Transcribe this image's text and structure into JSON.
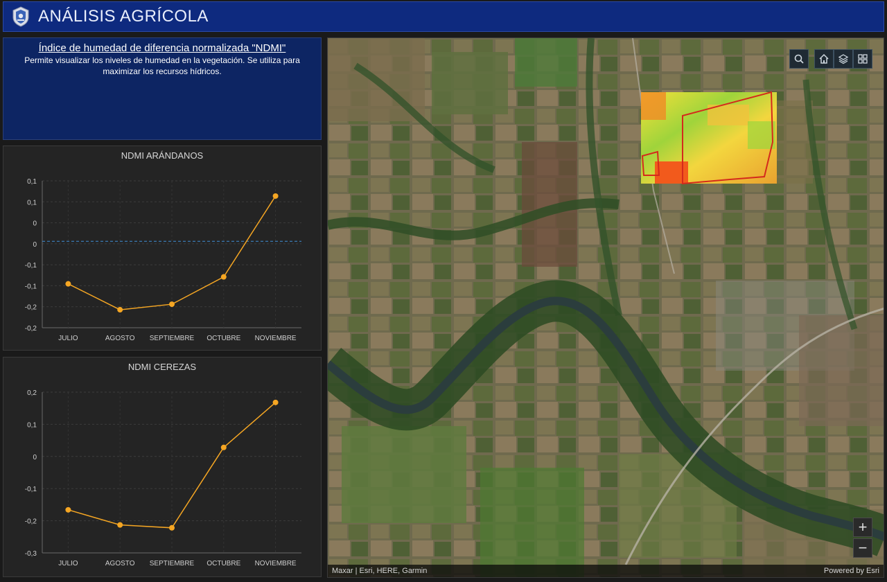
{
  "header": {
    "title": "ANÁLISIS AGRÍCOLA"
  },
  "info": {
    "title": "Índice de humedad de diferencia normalizada \"NDMI\"",
    "description": "Permite visualizar los niveles de humedad en la vegetación. Se utiliza para maximizar los recursos hídricos."
  },
  "charts": {
    "arandanos": {
      "title": "NDMI ARÁNDANOS",
      "y_tick_labels": [
        "0,1",
        "0,1",
        "0",
        "0",
        "-0,1",
        "-0,1",
        "-0,2",
        "-0,2"
      ]
    },
    "cerezas": {
      "title": "NDMI CEREZAS",
      "y_tick_labels": [
        "0,2",
        "0,1",
        "0",
        "-0,1",
        "-0,2",
        "-0,3"
      ]
    }
  },
  "chart_data": [
    {
      "type": "line",
      "title": "NDMI ARÁNDANOS",
      "categories": [
        "JULIO",
        "AGOSTO",
        "SEPTIEMBRE",
        "OCTUBRE",
        "NOVIEMBRE"
      ],
      "series": [
        {
          "values": [
            -0.123,
            -0.198,
            -0.182,
            -0.103,
            0.131
          ]
        }
      ],
      "ylim": [
        -0.25,
        0.175
      ],
      "reference_line": 0,
      "grid": true,
      "color": "#f5a623"
    },
    {
      "type": "line",
      "title": "NDMI CEREZAS",
      "categories": [
        "JULIO",
        "AGOSTO",
        "SEPTIEMBRE",
        "OCTUBRE",
        "NOVIEMBRE"
      ],
      "series": [
        {
          "values": [
            -0.166,
            -0.213,
            -0.222,
            0.028,
            0.168
          ]
        }
      ],
      "ylim": [
        -0.3,
        0.2
      ],
      "grid": true,
      "color": "#f5a623"
    }
  ],
  "map": {
    "tools": [
      {
        "icon": "search-icon"
      },
      {
        "icon": "home-icon"
      },
      {
        "icon": "layers-icon"
      },
      {
        "icon": "basemap-gallery-icon"
      }
    ],
    "zoom_in": "+",
    "zoom_out": "−",
    "attribution": "Maxar | Esri, HERE, Garmin",
    "powered_by": "Powered by Esri"
  },
  "colors": {
    "header_bg": "#0e2a7f",
    "panel_bg": "#242424",
    "series": "#f5a623",
    "reference": "#3f8fd8"
  }
}
